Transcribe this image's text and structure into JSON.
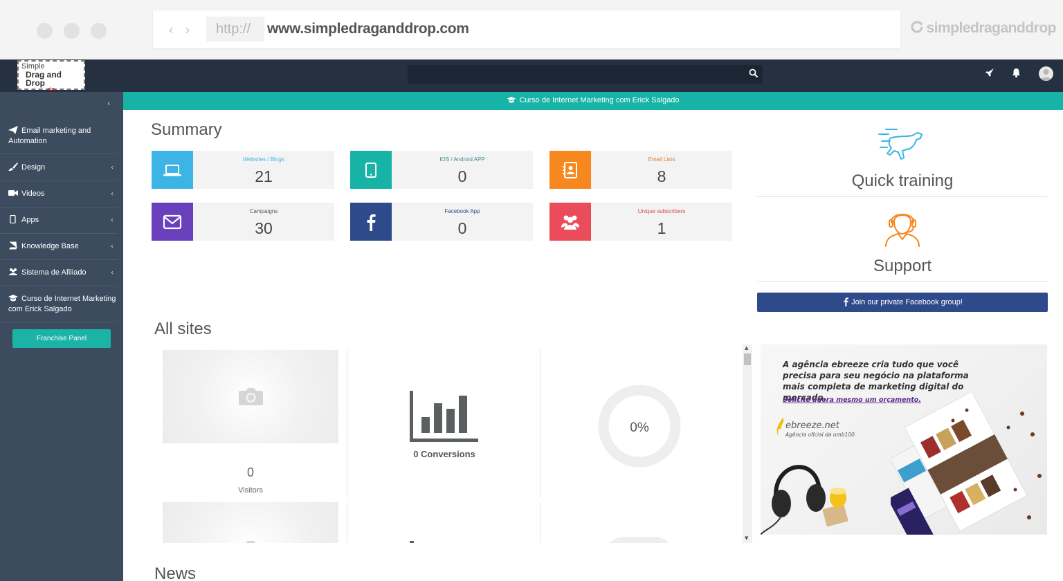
{
  "browser": {
    "protocol": "http://",
    "url": "www.simpledraganddrop.com",
    "brand": "simpledraganddrop"
  },
  "app": {
    "logo": {
      "line1": "Simple",
      "line2": "Drag and Drop",
      "line3": "obc"
    },
    "search_placeholder": ""
  },
  "sidebar": {
    "items": [
      {
        "label": "Email marketing and Automation",
        "icon": "paper-plane-icon"
      },
      {
        "label": "Design",
        "icon": "paint-brush-icon"
      },
      {
        "label": "Videos",
        "icon": "video-camera-icon"
      },
      {
        "label": "Apps",
        "icon": "tablet-icon"
      },
      {
        "label": "Knowledge Base",
        "icon": "book-icon"
      },
      {
        "label": "Sistema de Afiliado",
        "icon": "users-icon"
      },
      {
        "label": "Curso de Internet Marketing com Erick Salgado",
        "icon": "graduation-cap-icon"
      }
    ],
    "franchise_label": "Franchise Panel"
  },
  "banner": {
    "text": "Curso de Internet Marketing com Erick Salgado"
  },
  "summary": {
    "title": "Summary",
    "cards": [
      {
        "label": "Websites / Blogs",
        "value": "21",
        "color": "#3cb4e5",
        "label_color": "#3cb4e5",
        "icon": "laptop-icon"
      },
      {
        "label": "IOS / Android APP",
        "value": "0",
        "color": "#16b3a6",
        "label_color": "#3b8a8e",
        "icon": "tablet-icon"
      },
      {
        "label": "Email Lists",
        "value": "8",
        "color": "#f7881f",
        "label_color": "#e07a2c",
        "icon": "address-book-icon"
      },
      {
        "label": "Campaigns",
        "value": "30",
        "color": "#6a3fbb",
        "label_color": "#555555",
        "icon": "envelope-icon"
      },
      {
        "label": "Facebook App",
        "value": "0",
        "color": "#2f4a8a",
        "label_color": "#2f4a8a",
        "icon": "facebook-icon"
      },
      {
        "label": "Unique subscribers",
        "value": "1",
        "color": "#eb4c5c",
        "label_color": "#d44b57",
        "icon": "users-icon"
      }
    ]
  },
  "right": {
    "quick_training": "Quick training",
    "support": "Support",
    "facebook_group": "Join our private Facebook group!"
  },
  "all_sites": {
    "title": "All sites",
    "visitors_value": "0",
    "visitors_label": "Visitors",
    "conversions": "0 Conversions",
    "percent": "0%"
  },
  "ad": {
    "headline": "A agência ebreeze cria tudo que você precisa para seu negócio na plataforma mais completa de marketing digital do mercado.",
    "cta": "Solicite agora mesmo um orçamento.",
    "brand": "ebreeze.net",
    "brand_sub": "Agência oficial da omb100."
  },
  "news": {
    "title": "News"
  }
}
